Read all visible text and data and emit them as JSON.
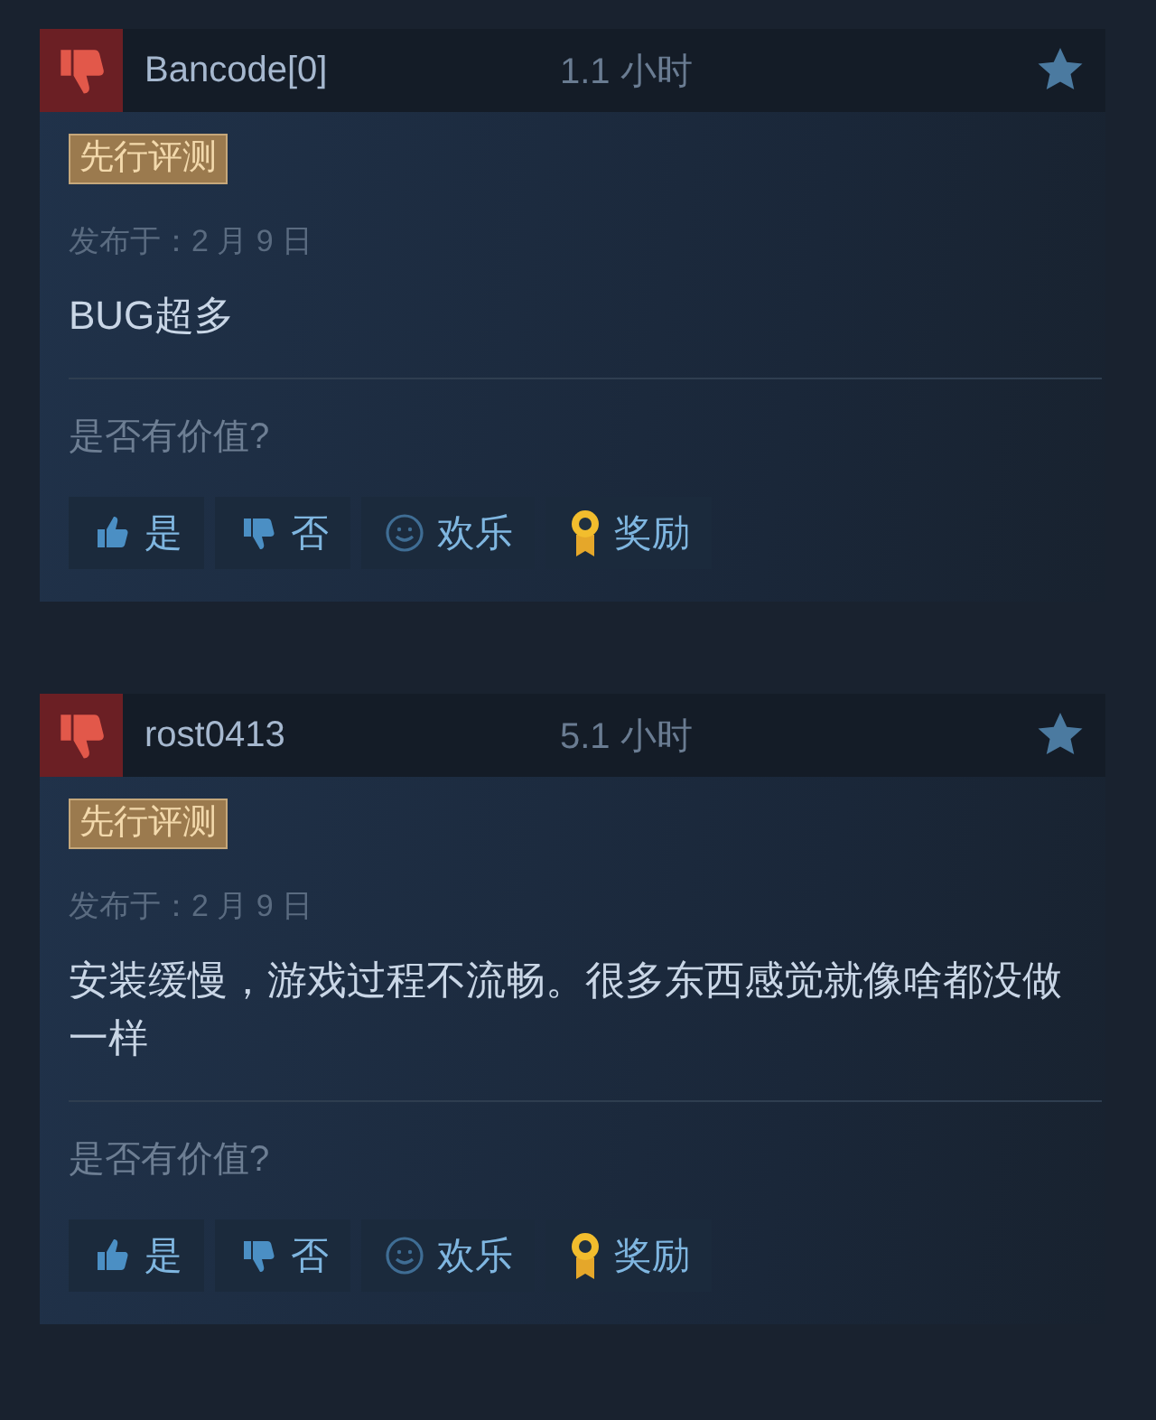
{
  "reviews": [
    {
      "recommended": false,
      "author": "Bancode[0]",
      "hours": "1.1 小时",
      "badge": "先行评测",
      "posted": "发布于：2 月 9 日",
      "text": "BUG超多",
      "question": "是否有价值?",
      "actions": [
        {
          "kind": "yes",
          "label": "是"
        },
        {
          "kind": "no",
          "label": "否"
        },
        {
          "kind": "funny",
          "label": "欢乐"
        },
        {
          "kind": "award",
          "label": "奖励"
        }
      ]
    },
    {
      "recommended": false,
      "author": "rost0413",
      "hours": "5.1 小时",
      "badge": "先行评测",
      "posted": "发布于：2 月 9 日",
      "text": "安装缓慢，游戏过程不流畅。很多东西感觉就像啥都没做一样",
      "question": "是否有价值?",
      "actions": [
        {
          "kind": "yes",
          "label": "是"
        },
        {
          "kind": "no",
          "label": "否"
        },
        {
          "kind": "funny",
          "label": "欢乐"
        },
        {
          "kind": "award",
          "label": "奖励"
        }
      ]
    }
  ]
}
